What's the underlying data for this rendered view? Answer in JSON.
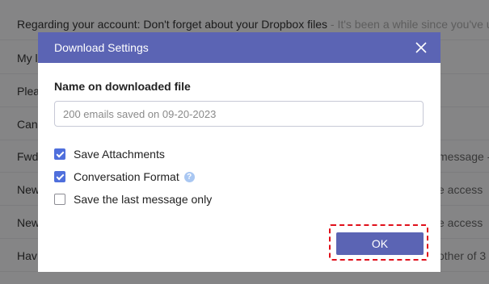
{
  "email_list": {
    "rows": [
      {
        "subject": "Regarding your account: Don't forget about your Dropbox files",
        "snippet": " - It's been a while since you've u",
        "right": ""
      },
      {
        "subject": "My l",
        "snippet": "",
        "right": ""
      },
      {
        "subject": "Plea",
        "snippet": "",
        "right": ""
      },
      {
        "subject": "Can",
        "snippet": "",
        "right": ""
      },
      {
        "subject": "Fwd",
        "snippet": "",
        "right": "message -"
      },
      {
        "subject": "New",
        "snippet": "",
        "right": "e access"
      },
      {
        "subject": "New",
        "snippet": "",
        "right": "e access"
      },
      {
        "subject": "Hav",
        "snippet": "",
        "right": "other of 3"
      }
    ]
  },
  "dialog": {
    "title": "Download Settings",
    "close_icon": "close-icon",
    "name_label": "Name on downloaded file",
    "name_placeholder": "200 emails saved on 09-20-2023",
    "name_value": "",
    "options": [
      {
        "label": "Save Attachments",
        "checked": true,
        "help": false
      },
      {
        "label": "Conversation Format",
        "checked": true,
        "help": true
      },
      {
        "label": "Save the last message only",
        "checked": false,
        "help": false
      }
    ],
    "ok_label": "OK"
  },
  "colors": {
    "header": "#5b64b4",
    "checkbox": "#4f6fdc",
    "help": "#a9c7f2",
    "highlight": "#e0101a"
  }
}
